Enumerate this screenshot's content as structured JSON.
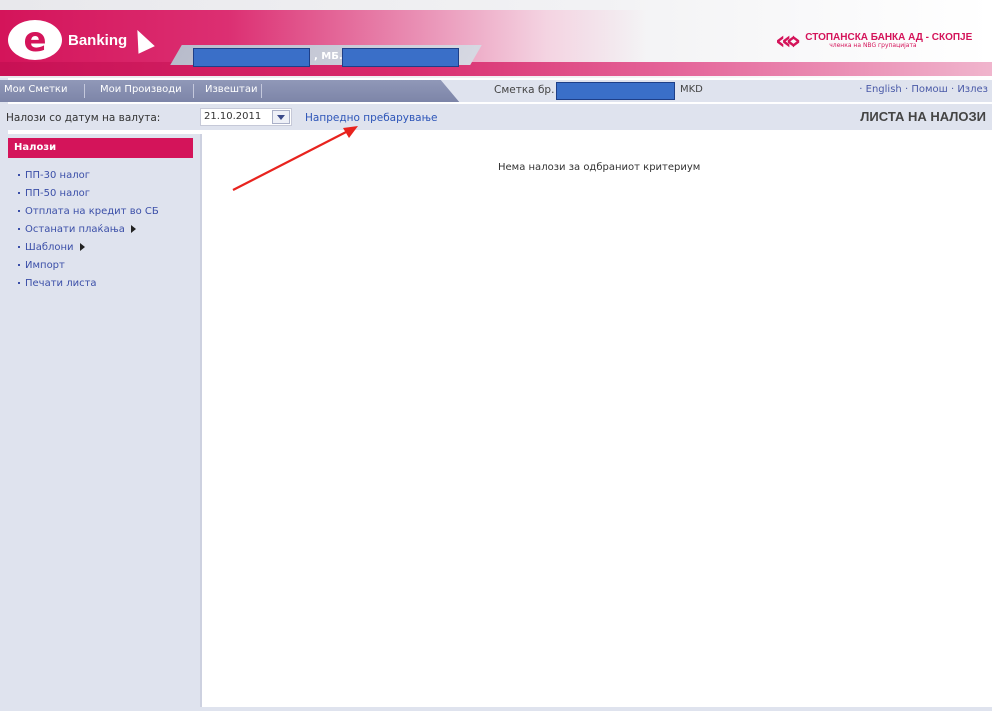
{
  "header": {
    "logo_letter": "e",
    "logo_text": "Banking",
    "mb_label": ", МБ.",
    "bank_name": "СТОПАНСКА БАНКА АД - СКОПЈЕ",
    "bank_subtitle": "членка на NBG групацијата"
  },
  "nav": {
    "items": [
      {
        "label": "Мои Сметки"
      },
      {
        "label": "Мои Производи"
      },
      {
        "label": "Извештаи"
      }
    ],
    "account_label": "Сметка бр.",
    "currency": "MKD",
    "links": [
      {
        "label": "English"
      },
      {
        "label": "Помош"
      },
      {
        "label": "Излез"
      }
    ],
    "link_separator": "·"
  },
  "filter": {
    "label": "Налози со датум на валута:",
    "date_value": "21.10.2011",
    "advanced_search": "Напредно пребарување",
    "page_title": "ЛИСТА НА НАЛОЗИ"
  },
  "sidebar": {
    "title": "Налози",
    "items": [
      {
        "label": "ПП-30 налог",
        "has_submenu": false
      },
      {
        "label": "ПП-50 налог",
        "has_submenu": false
      },
      {
        "label": "Отплата на кредит во СБ",
        "has_submenu": false
      },
      {
        "label": "Останати плаќања",
        "has_submenu": true
      },
      {
        "label": "Шаблони",
        "has_submenu": true
      },
      {
        "label": "Импорт",
        "has_submenu": false
      },
      {
        "label": "Печати листа",
        "has_submenu": false
      }
    ]
  },
  "main": {
    "empty_message": "Нема налози за одбраниот критериум"
  },
  "colors": {
    "brand": "#d4145a",
    "nav": "#7d85a8",
    "panel": "#dfe3ee",
    "link": "#2d55b8",
    "redaction": "#3a6fc8",
    "annotation_arrow": "#e8231e"
  },
  "icons": {
    "date_dropdown": "chevron-down-icon",
    "submenu": "caret-right-icon",
    "annotation": "red-arrow-icon"
  }
}
